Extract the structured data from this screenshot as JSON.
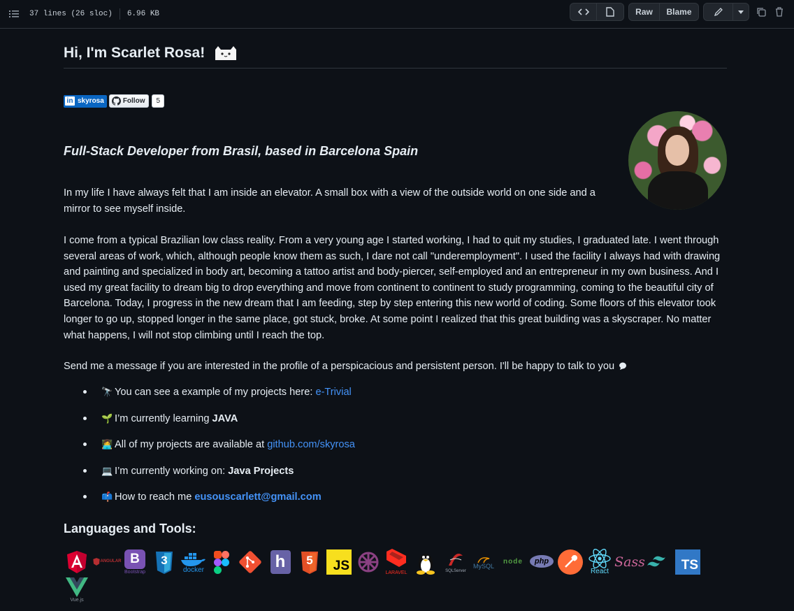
{
  "toolbar": {
    "lines_info": "37 lines (26 sloc)",
    "size_info": "6.96 KB",
    "raw_label": "Raw",
    "blame_label": "Blame"
  },
  "readme": {
    "title": "Hi, I'm Scarlet Rosa!",
    "badge_linkedin": "skyrosa",
    "badge_follow": "Follow",
    "badge_follow_count": "5",
    "subtitle": "Full-Stack Developer from Brasil, based in Barcelona Spain",
    "para1": "In my life I have always felt that I am inside an elevator. A small box with a view of the outside world on one side and a mirror to see myself inside.",
    "para2": "I come from a typical Brazilian low class reality. From a very young age I started working, I had to quit my studies, I graduated late. I went through several areas of work, which, although people know them as such, I dare not call \"underemployment\". I used the facility I always had with drawing and painting and specialized in body art, becoming a tattoo artist and body-piercer, self-employed and an entrepreneur in my own business. And I used my great facility to dream big to drop everything and move from continent to continent to study programming, coming to the beautiful city of Barcelona. Today, I progress in the new dream that I am feeding, step by step entering this new world of coding. Some floors of this elevator took longer to go up, stopped longer in the same place, got stuck, broke. At some point I realized that this great building was a skyscraper. No matter what happens, I will not stop climbing until I reach the top.",
    "para3": "Send me a message if you are interested in the profile of a perspicacious and persistent person. I'll be happy to talk to you",
    "list": [
      {
        "emoji": "🔭",
        "text": "You can see a example of my projects here: ",
        "link": "e-Trivial"
      },
      {
        "emoji": "🌱",
        "text": "I’m currently learning ",
        "bold": "JAVA"
      },
      {
        "emoji": "👩‍💻",
        "text": "All of my projects are available at ",
        "link": "github.com/skyrosa"
      },
      {
        "emoji": "💻",
        "text": "I’m currently working on: ",
        "bold": "Java Projects"
      },
      {
        "emoji": "📫",
        "text": "How to reach me ",
        "bold_link": "eusouscarlett@gmail.com"
      }
    ],
    "tools_heading": "Languages and Tools:",
    "tools": [
      {
        "name": "Angular",
        "label": "A",
        "color": "#dd0031"
      },
      {
        "name": "AngularJS",
        "label": "ANGULAR",
        "color": "#b52e31"
      },
      {
        "name": "Bootstrap",
        "label": "B",
        "caption": "Bootstrap",
        "color": "#7952b3"
      },
      {
        "name": "CSS3",
        "label": "3",
        "color": "#1572b6"
      },
      {
        "name": "Docker",
        "label": "docker",
        "color": "#2496ed"
      },
      {
        "name": "Figma",
        "label": "",
        "color": "#f24e1e"
      },
      {
        "name": "Git",
        "label": "",
        "color": "#f05032"
      },
      {
        "name": "Heroku",
        "label": "h",
        "color": "#6762a6"
      },
      {
        "name": "HTML5",
        "label": "5",
        "color": "#e34f26"
      },
      {
        "name": "JavaScript",
        "label": "JS",
        "color": "#f7df1e"
      },
      {
        "name": "Jasmine",
        "label": "",
        "color": "#8a4182"
      },
      {
        "name": "Laravel",
        "label": "LARAVEL",
        "color": "#ff2d20"
      },
      {
        "name": "Linux",
        "label": "",
        "color": "#ffffff"
      },
      {
        "name": "MSSQL",
        "label": "SQLServer",
        "color": "#cc2927"
      },
      {
        "name": "MySQL",
        "label": "MySQL",
        "color": "#4479a1"
      },
      {
        "name": "Node.js",
        "label": "node",
        "color": "#539e43"
      },
      {
        "name": "PHP",
        "label": "php",
        "color": "#777bb4"
      },
      {
        "name": "Postman",
        "label": "",
        "color": "#ff6c37"
      },
      {
        "name": "React",
        "label": "React",
        "color": "#61dafb"
      },
      {
        "name": "Sass",
        "label": "Sass",
        "color": "#cc6699"
      },
      {
        "name": "Tailwind",
        "label": "",
        "color": "#38b2ac"
      },
      {
        "name": "TypeScript",
        "label": "TS",
        "color": "#3178c6"
      },
      {
        "name": "Vue.js",
        "label": "Vue.js",
        "color": "#41b883"
      }
    ]
  }
}
